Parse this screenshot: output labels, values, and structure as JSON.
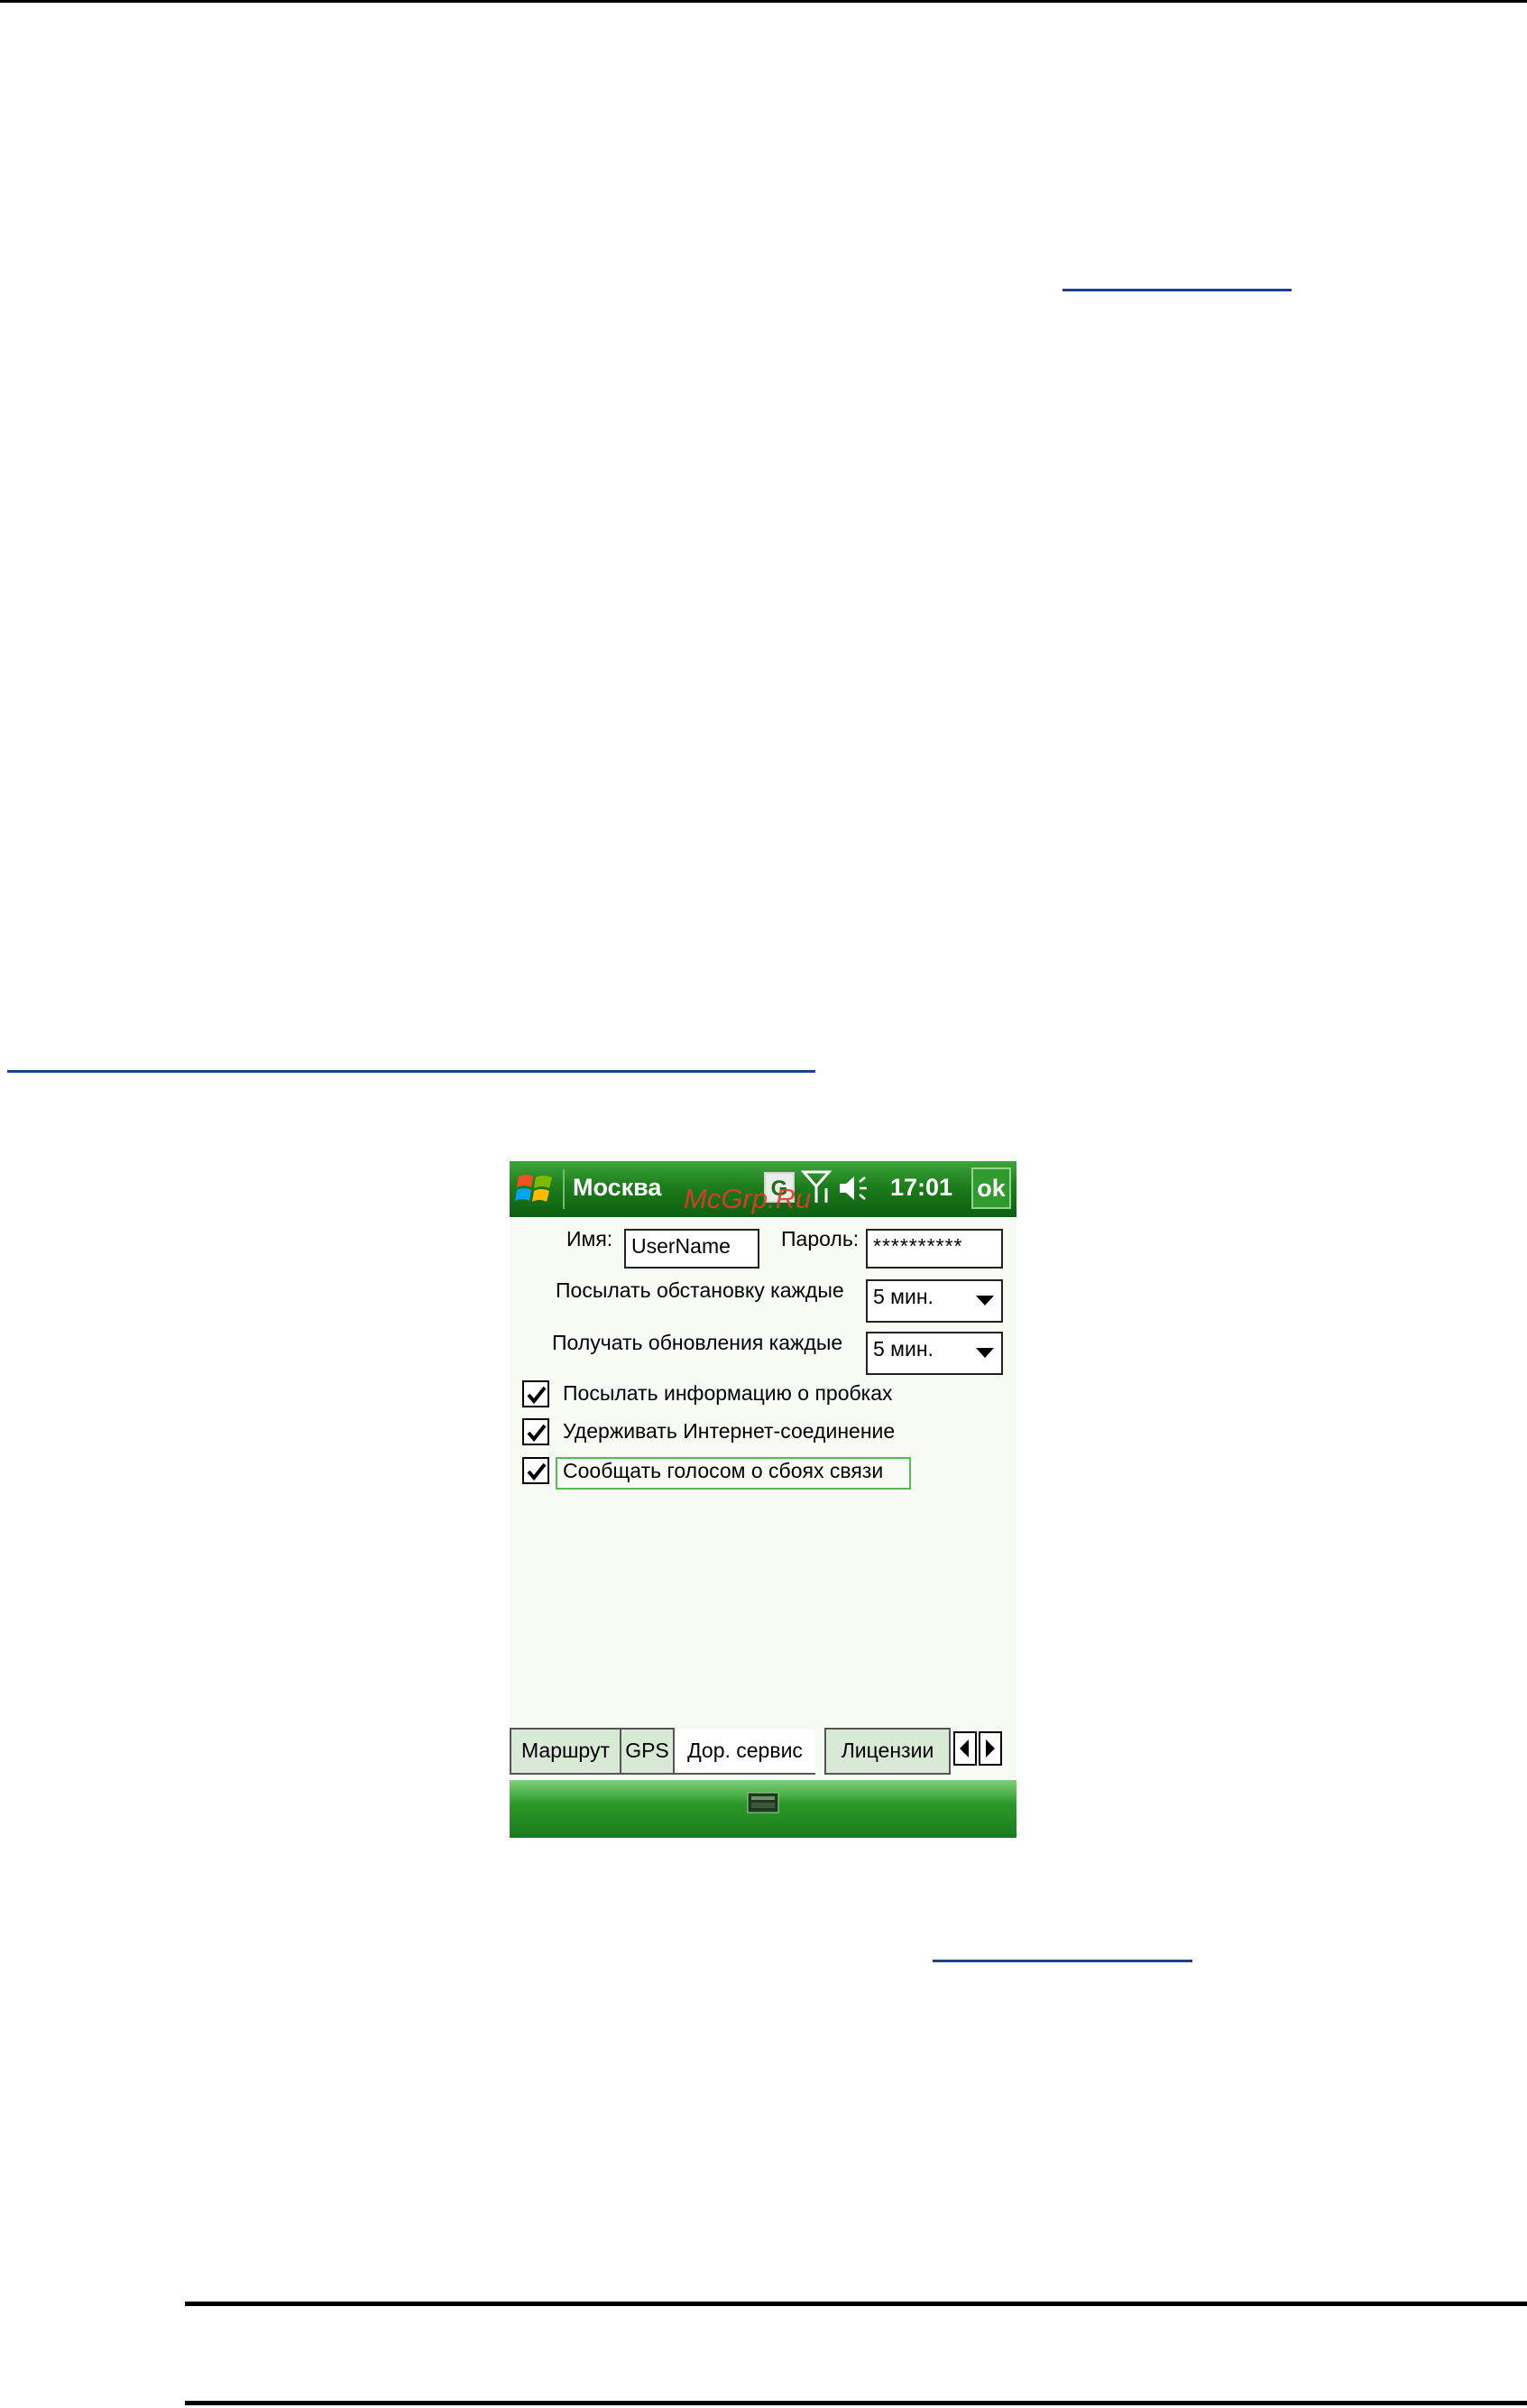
{
  "phone": {
    "title": "Москва",
    "gprs_letter": "G",
    "clock": "17:01",
    "ok_label": "ok",
    "watermark": "McGrp.Ru",
    "name_label": "Имя:",
    "name_value": "UserName",
    "password_label": "Пароль:",
    "password_value": "**********",
    "send_label": "Посылать обстановку каждые",
    "send_value": "5 мин.",
    "receive_label": "Получать обновления каждые",
    "receive_value": "5 мин.",
    "checkboxes": [
      {
        "label": "Посылать информацию о пробках",
        "checked": true
      },
      {
        "label": "Удерживать Интернет-соединение",
        "checked": true
      },
      {
        "label": "Сообщать голосом о сбоях связи",
        "checked": true
      }
    ],
    "tabs": [
      {
        "label": "Маршрут"
      },
      {
        "label": "GPS"
      },
      {
        "label": "Дор. сервис",
        "active": true
      },
      {
        "label": "Лицензии"
      }
    ],
    "icons": {
      "start": "windows-start-icon",
      "signal": "signal-icon",
      "volume": "volume-icon",
      "keyboard": "keyboard-icon",
      "tab_left": "arrow-left-icon",
      "tab_right": "arrow-right-icon"
    },
    "colors": {
      "titlebar": "#1d7d1c",
      "focus_border": "#56b856",
      "watermark": "#e33b2b"
    }
  }
}
